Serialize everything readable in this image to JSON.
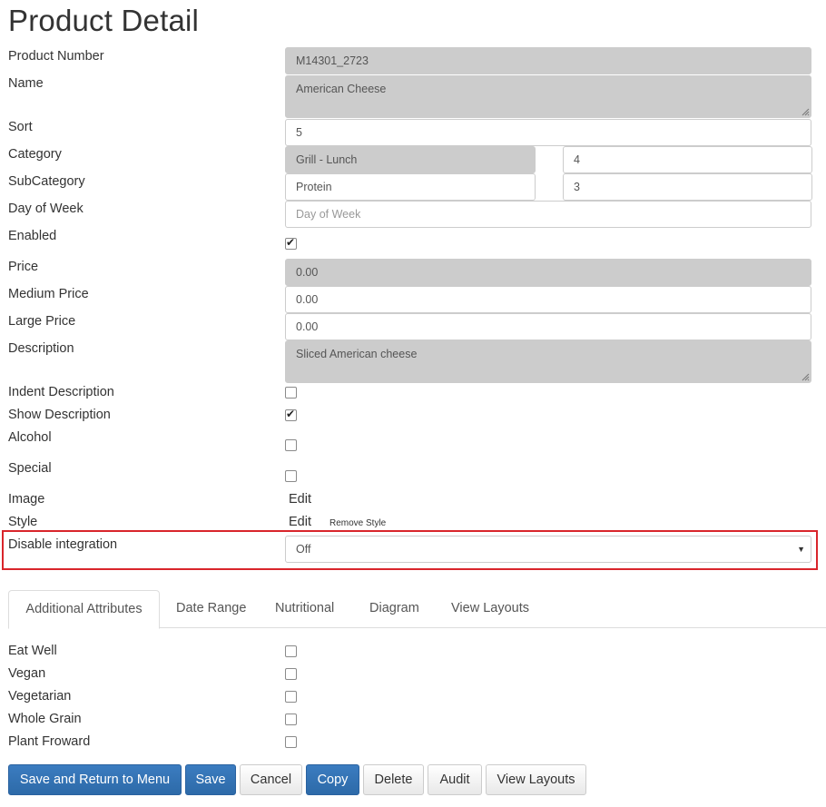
{
  "page": {
    "title": "Product Detail"
  },
  "fields": {
    "product_number": {
      "label": "Product Number",
      "value": "M14301_2723"
    },
    "name": {
      "label": "Name",
      "value": "American Cheese"
    },
    "sort": {
      "label": "Sort",
      "value": "5"
    },
    "category": {
      "label": "Category",
      "value": "Grill - Lunch",
      "secondary": "4"
    },
    "subcategory": {
      "label": "SubCategory",
      "value": "Protein",
      "secondary": "3"
    },
    "day_of_week": {
      "label": "Day of Week",
      "placeholder": "Day of Week"
    },
    "enabled": {
      "label": "Enabled",
      "checked": true
    },
    "price": {
      "label": "Price",
      "value": "0.00"
    },
    "medium_price": {
      "label": "Medium Price",
      "value": "0.00"
    },
    "large_price": {
      "label": "Large Price",
      "value": "0.00"
    },
    "description": {
      "label": "Description",
      "value": "Sliced American cheese"
    },
    "indent_description": {
      "label": "Indent Description",
      "checked": false
    },
    "show_description": {
      "label": "Show Description",
      "checked": true
    },
    "alcohol": {
      "label": "Alcohol",
      "checked": false
    },
    "special": {
      "label": "Special",
      "checked": false
    },
    "image": {
      "label": "Image",
      "action": "Edit"
    },
    "style": {
      "label": "Style",
      "action": "Edit",
      "remove": "Remove Style"
    },
    "disable_integration": {
      "label": "Disable integration",
      "value": "Off"
    }
  },
  "tabs": [
    {
      "label": "Additional Attributes",
      "active": true
    },
    {
      "label": "Date Range"
    },
    {
      "label": "Nutritional"
    },
    {
      "label": "Diagram"
    },
    {
      "label": "View Layouts"
    }
  ],
  "attributes": [
    {
      "label": "Eat Well",
      "checked": false
    },
    {
      "label": "Vegan",
      "checked": false
    },
    {
      "label": "Vegetarian",
      "checked": false
    },
    {
      "label": "Whole Grain",
      "checked": false
    },
    {
      "label": "Plant Froward",
      "checked": false
    }
  ],
  "buttons": {
    "save_return": "Save and Return to Menu",
    "save": "Save",
    "cancel": "Cancel",
    "copy": "Copy",
    "delete": "Delete",
    "audit": "Audit",
    "view_layouts": "View Layouts"
  },
  "colors": {
    "primary": "#337ab7",
    "highlight": "#d9252b",
    "readonly_bg": "#cccccc"
  }
}
